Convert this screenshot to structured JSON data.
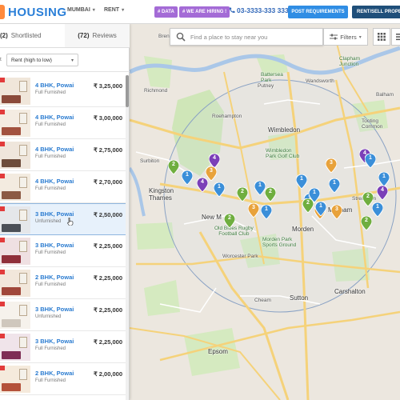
{
  "header": {
    "logo_text": "HOUSING",
    "nav": [
      {
        "label": "MUMBAI"
      },
      {
        "label": "RENT"
      }
    ],
    "badge_data": "# DATA",
    "badge_hiring": "# WE ARE HIRING !",
    "phone": "03-3333-333 333",
    "post_button": "POST REQUIREMENTS",
    "rent_sell_button": "RENT/SELL PROPER",
    "colors": {
      "brand": "#2a7fd8",
      "badge": "#a46bd6",
      "post": "#2f8de4",
      "rent": "#1f4f7a"
    }
  },
  "search": {
    "placeholder": "Find a place to stay near you",
    "filters_label": "Filters"
  },
  "panel": {
    "tab_shortlisted_count": "(2)",
    "tab_shortlisted_label": "Shortlisted",
    "tab_reviews_count": "(72)",
    "tab_reviews_label": "Reviews",
    "sort_prefix": "t",
    "sort_value": "Rent (high to low)",
    "listings": [
      {
        "title": "4 BHK, Powai",
        "furnishing": "Full Furnished",
        "price": "₹ 3,25,000",
        "highlight": false
      },
      {
        "title": "4 BHK, Powai",
        "furnishing": "Full Furnished",
        "price": "₹ 3,00,000",
        "highlight": false
      },
      {
        "title": "4 BHK, Powai",
        "furnishing": "Full Furnished",
        "price": "₹ 2,75,000",
        "highlight": false
      },
      {
        "title": "4 BHK, Powai",
        "furnishing": "Full Furnished",
        "price": "₹ 2,70,000",
        "highlight": false
      },
      {
        "title": "3 BHK, Powai",
        "furnishing": "Unfurnished",
        "price": "₹ 2,50,000",
        "highlight": true
      },
      {
        "title": "3 BHK, Powai",
        "furnishing": "Full Furnished",
        "price": "₹ 2,25,000",
        "highlight": false
      },
      {
        "title": "2 BHK, Powai",
        "furnishing": "Full Furnished",
        "price": "₹ 2,25,000",
        "highlight": false
      },
      {
        "title": "3 BHK, Powai",
        "furnishing": "Unfurnished",
        "price": "₹ 2,25,000",
        "highlight": false
      },
      {
        "title": "3 BHK, Powai",
        "furnishing": "Full Furnished",
        "price": "₹ 2,25,000",
        "highlight": false
      },
      {
        "title": "2 BHK, Powai",
        "furnishing": "Full Furnished",
        "price": "₹ 2,00,000",
        "highlight": false
      }
    ]
  },
  "map_labels": {
    "brentford": "Brentford",
    "richmond": "Richmond",
    "putney": "Putney",
    "wandsworth": "Wandsworth",
    "roehampton": "Roehampton",
    "wimbledon": "Wimbledon",
    "kingston": "Kingston\nThames",
    "new_malden": "New M",
    "morden": "Morden",
    "mitcham": "Mitcham",
    "sutton": "Sutton",
    "carshalton": "Carshalton",
    "cheam": "Cheam",
    "epsom": "Epsom",
    "worcester_park": "Worcester Park",
    "surbiton": "Surbiton",
    "tooting": "Tooting\nCommon",
    "streatham": "Streatham",
    "old_blues": "Old Blues Rugby\nFootball Club",
    "wimbledon_golf": "Wimbledon\nPark Golf Club",
    "morden_park": "Morden Park\nSports Ground",
    "clapham": "Clapham\nJunction",
    "battersea": "Battersea\nPark",
    "balham": "Balham"
  },
  "pins": [
    {
      "label": "2",
      "color": "#6fae3f"
    },
    {
      "label": "1",
      "color": "#3b8fd9"
    },
    {
      "label": "4",
      "color": "#7b3fb8"
    },
    {
      "label": "3",
      "color": "#e8a23b"
    },
    {
      "label": "2",
      "color": "#6fae3f"
    },
    {
      "label": "1",
      "color": "#3b8fd9"
    },
    {
      "label": "4",
      "color": "#7b3fb8"
    },
    {
      "label": "1",
      "color": "#3b8fd9"
    },
    {
      "label": "2",
      "color": "#6fae3f"
    },
    {
      "label": "3",
      "color": "#e8a23b"
    },
    {
      "label": "2",
      "color": "#6fae3f"
    },
    {
      "label": "1",
      "color": "#3b8fd9"
    },
    {
      "label": "1",
      "color": "#3b8fd9"
    },
    {
      "label": "3",
      "color": "#e8a23b"
    },
    {
      "label": "1",
      "color": "#3b8fd9"
    },
    {
      "label": "1",
      "color": "#3b8fd9"
    },
    {
      "label": "2",
      "color": "#6fae3f"
    },
    {
      "label": "4",
      "color": "#7b3fb8"
    },
    {
      "label": "3",
      "color": "#e8a23b"
    },
    {
      "label": "1",
      "color": "#3b8fd9"
    },
    {
      "label": "2",
      "color": "#6fae3f"
    },
    {
      "label": "1",
      "color": "#3b8fd9"
    },
    {
      "label": "3",
      "color": "#e8a23b"
    },
    {
      "label": "1",
      "color": "#3b8fd9"
    },
    {
      "label": "1",
      "color": "#3b8fd9"
    },
    {
      "label": "2",
      "color": "#6fae3f"
    },
    {
      "label": "4",
      "color": "#7b3fb8"
    },
    {
      "label": "1",
      "color": "#3b8fd9"
    }
  ]
}
